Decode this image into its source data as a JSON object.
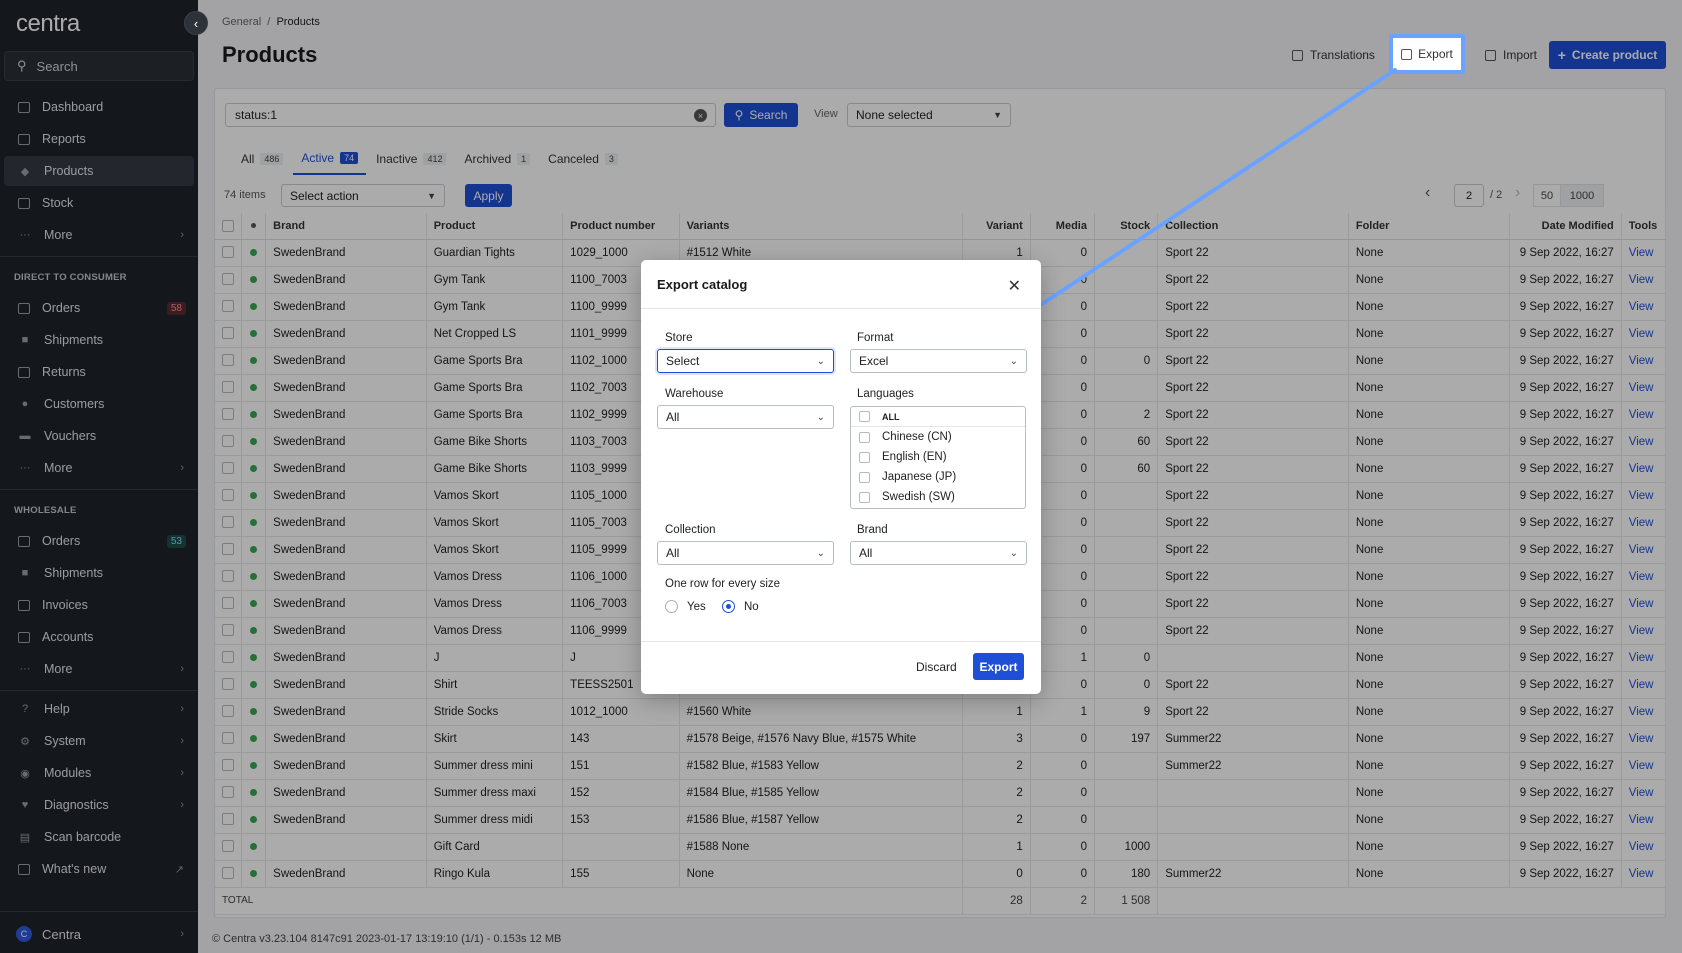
{
  "sidebar": {
    "logo": "centra",
    "search_label": "Search",
    "main_items": [
      {
        "label": "Dashboard"
      },
      {
        "label": "Reports"
      },
      {
        "label": "Products"
      },
      {
        "label": "Stock"
      },
      {
        "label": "More"
      }
    ],
    "dtc_title": "DIRECT TO CONSUMER",
    "dtc_items": [
      {
        "label": "Orders",
        "badge": "58"
      },
      {
        "label": "Shipments"
      },
      {
        "label": "Returns"
      },
      {
        "label": "Customers"
      },
      {
        "label": "Vouchers"
      },
      {
        "label": "More"
      }
    ],
    "wholesale_title": "WHOLESALE",
    "wholesale_items": [
      {
        "label": "Orders",
        "badge": "53"
      },
      {
        "label": "Shipments"
      },
      {
        "label": "Invoices"
      },
      {
        "label": "Accounts"
      },
      {
        "label": "More"
      }
    ],
    "bottom_items": [
      {
        "label": "Help"
      },
      {
        "label": "System"
      },
      {
        "label": "Modules"
      },
      {
        "label": "Diagnostics"
      },
      {
        "label": "Scan barcode"
      },
      {
        "label": "What's new"
      }
    ],
    "user": {
      "initial": "C",
      "name": "Centra"
    }
  },
  "header": {
    "breadcrumb_parent": "General",
    "breadcrumb_sep": "/",
    "breadcrumb_current": "Products",
    "title": "Products",
    "translations": "Translations",
    "export": "Export",
    "import": "Import",
    "create": "Create product"
  },
  "filters": {
    "query": "status:1",
    "search_button": "Search",
    "view_label": "View",
    "view_value": "None selected"
  },
  "tabs": [
    {
      "label": "All",
      "count": "486"
    },
    {
      "label": "Active",
      "count": "74"
    },
    {
      "label": "Inactive",
      "count": "412"
    },
    {
      "label": "Archived",
      "count": "1"
    },
    {
      "label": "Canceled",
      "count": "3"
    }
  ],
  "toolbar": {
    "items_count": "74 items",
    "action_placeholder": "Select action",
    "apply": "Apply",
    "page": "2",
    "page_total": "/ 2",
    "per_page_a": "50",
    "per_page_b": "1000"
  },
  "table": {
    "columns": [
      "Brand",
      "Product",
      "Product number",
      "Variants",
      "Variant",
      "Media",
      "Stock",
      "Collection",
      "Folder",
      "Date Modified",
      "Tools"
    ],
    "rows": [
      [
        "SwedenBrand",
        "Guardian Tights",
        "1029_1000",
        "#1512 White",
        "1",
        "0",
        "",
        "Sport 22",
        "None",
        "9 Sep 2022, 16:27",
        "View"
      ],
      [
        "SwedenBrand",
        "Gym Tank",
        "1100_7003",
        "",
        "",
        "0",
        "",
        "Sport 22",
        "None",
        "9 Sep 2022, 16:27",
        "View"
      ],
      [
        "SwedenBrand",
        "Gym Tank",
        "1100_9999",
        "",
        "",
        "0",
        "",
        "Sport 22",
        "None",
        "9 Sep 2022, 16:27",
        "View"
      ],
      [
        "SwedenBrand",
        "Net Cropped LS",
        "1101_9999",
        "",
        "",
        "0",
        "",
        "Sport 22",
        "None",
        "9 Sep 2022, 16:27",
        "View"
      ],
      [
        "SwedenBrand",
        "Game Sports Bra",
        "1102_1000",
        "",
        "",
        "0",
        "0",
        "Sport 22",
        "None",
        "9 Sep 2022, 16:27",
        "View"
      ],
      [
        "SwedenBrand",
        "Game Sports Bra",
        "1102_7003",
        "",
        "",
        "0",
        "",
        "Sport 22",
        "None",
        "9 Sep 2022, 16:27",
        "View"
      ],
      [
        "SwedenBrand",
        "Game Sports Bra",
        "1102_9999",
        "",
        "",
        "0",
        "2",
        "Sport 22",
        "None",
        "9 Sep 2022, 16:27",
        "View"
      ],
      [
        "SwedenBrand",
        "Game Bike Shorts",
        "1103_7003",
        "",
        "",
        "0",
        "60",
        "Sport 22",
        "None",
        "9 Sep 2022, 16:27",
        "View"
      ],
      [
        "SwedenBrand",
        "Game Bike Shorts",
        "1103_9999",
        "",
        "",
        "0",
        "60",
        "Sport 22",
        "None",
        "9 Sep 2022, 16:27",
        "View"
      ],
      [
        "SwedenBrand",
        "Vamos Skort",
        "1105_1000",
        "",
        "",
        "0",
        "",
        "Sport 22",
        "None",
        "9 Sep 2022, 16:27",
        "View"
      ],
      [
        "SwedenBrand",
        "Vamos Skort",
        "1105_7003",
        "",
        "",
        "0",
        "",
        "Sport 22",
        "None",
        "9 Sep 2022, 16:27",
        "View"
      ],
      [
        "SwedenBrand",
        "Vamos Skort",
        "1105_9999",
        "",
        "",
        "0",
        "",
        "Sport 22",
        "None",
        "9 Sep 2022, 16:27",
        "View"
      ],
      [
        "SwedenBrand",
        "Vamos Dress",
        "1106_1000",
        "",
        "",
        "0",
        "",
        "Sport 22",
        "None",
        "9 Sep 2022, 16:27",
        "View"
      ],
      [
        "SwedenBrand",
        "Vamos Dress",
        "1106_7003",
        "",
        "",
        "0",
        "",
        "Sport 22",
        "None",
        "9 Sep 2022, 16:27",
        "View"
      ],
      [
        "SwedenBrand",
        "Vamos Dress",
        "1106_9999",
        "",
        "",
        "0",
        "",
        "Sport 22",
        "None",
        "9 Sep 2022, 16:27",
        "View"
      ],
      [
        "SwedenBrand",
        "J",
        "J",
        "",
        "",
        "1",
        "0",
        "",
        "None",
        "9 Sep 2022, 16:27",
        "View"
      ],
      [
        "SwedenBrand",
        "Shirt",
        "TEESS2501",
        "",
        "",
        "0",
        "0",
        "Sport 22",
        "None",
        "9 Sep 2022, 16:27",
        "View"
      ],
      [
        "SwedenBrand",
        "Stride Socks",
        "1012_1000",
        "#1560 White",
        "1",
        "1",
        "9",
        "Sport 22",
        "None",
        "9 Sep 2022, 16:27",
        "View"
      ],
      [
        "SwedenBrand",
        "Skirt",
        "143",
        "#1578 Beige, #1576 Navy Blue, #1575 White",
        "3",
        "0",
        "197",
        "Summer22",
        "None",
        "9 Sep 2022, 16:27",
        "View"
      ],
      [
        "SwedenBrand",
        "Summer dress mini",
        "151",
        "#1582 Blue, #1583 Yellow",
        "2",
        "0",
        "",
        "Summer22",
        "None",
        "9 Sep 2022, 16:27",
        "View"
      ],
      [
        "SwedenBrand",
        "Summer dress maxi",
        "152",
        "#1584 Blue, #1585 Yellow",
        "2",
        "0",
        "",
        "",
        "None",
        "9 Sep 2022, 16:27",
        "View"
      ],
      [
        "SwedenBrand",
        "Summer dress midi",
        "153",
        "#1586 Blue, #1587 Yellow",
        "2",
        "0",
        "",
        "",
        "None",
        "9 Sep 2022, 16:27",
        "View"
      ],
      [
        "",
        "Gift Card",
        "",
        "#1588 None",
        "1",
        "0",
        "1000",
        "",
        "None",
        "9 Sep 2022, 16:27",
        "View"
      ],
      [
        "SwedenBrand",
        "Ringo Kula",
        "155",
        "None",
        "0",
        "0",
        "180",
        "Summer22",
        "None",
        "9 Sep 2022, 16:27",
        "View"
      ]
    ],
    "total_label": "TOTAL",
    "total_variant": "28",
    "total_media": "2",
    "total_stock": "1 508"
  },
  "footer": {
    "copyright": "© Centra v3.23.104 8147c91 2023-01-17 13:19:10 (1/1) - 0.153s 12 MB"
  },
  "modal": {
    "title": "Export catalog",
    "store_label": "Store",
    "store_value": "Select",
    "format_label": "Format",
    "format_value": "Excel",
    "warehouse_label": "Warehouse",
    "warehouse_value": "All",
    "languages_label": "Languages",
    "languages": [
      "ALL",
      "Chinese (CN)",
      "English (EN)",
      "Japanese (JP)",
      "Swedish (SW)"
    ],
    "collection_label": "Collection",
    "collection_value": "All",
    "brand_label": "Brand",
    "brand_value": "All",
    "size_label": "One row for every size",
    "yes": "Yes",
    "no": "No",
    "discard": "Discard",
    "export": "Export"
  },
  "colors": {
    "accent": "#1e4fd6",
    "sidebar": "#1f2329",
    "highlight": "#6aa3ff",
    "active_dot": "#3aa655"
  }
}
